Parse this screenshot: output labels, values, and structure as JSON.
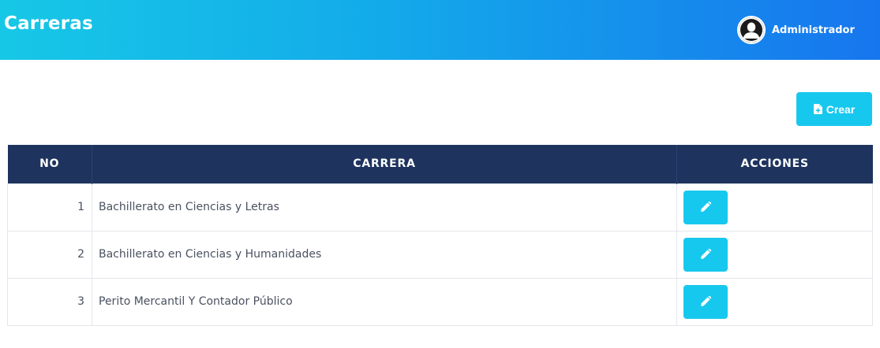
{
  "header": {
    "title": "Carreras",
    "user_name": "Administrador",
    "avatar_icon": "user-silhouette-icon"
  },
  "toolbar": {
    "create_label": "Crear",
    "create_icon": "file-plus-icon"
  },
  "table": {
    "columns": [
      "NO",
      "CARRERA",
      "ACCIONES"
    ],
    "rows": [
      {
        "no": "1",
        "carrera": "Bachillerato en Ciencias y Letras"
      },
      {
        "no": "2",
        "carrera": "Bachillerato en Ciencias y Humanidades"
      },
      {
        "no": "3",
        "carrera": "Perito Mercantil Y Contador Público"
      }
    ],
    "action_icon": "pencil-icon"
  },
  "colors": {
    "header_gradient_start": "#17c8e6",
    "header_gradient_end": "#1776ee",
    "table_header_bg": "#1e345e",
    "accent_button": "#17c8ee"
  }
}
